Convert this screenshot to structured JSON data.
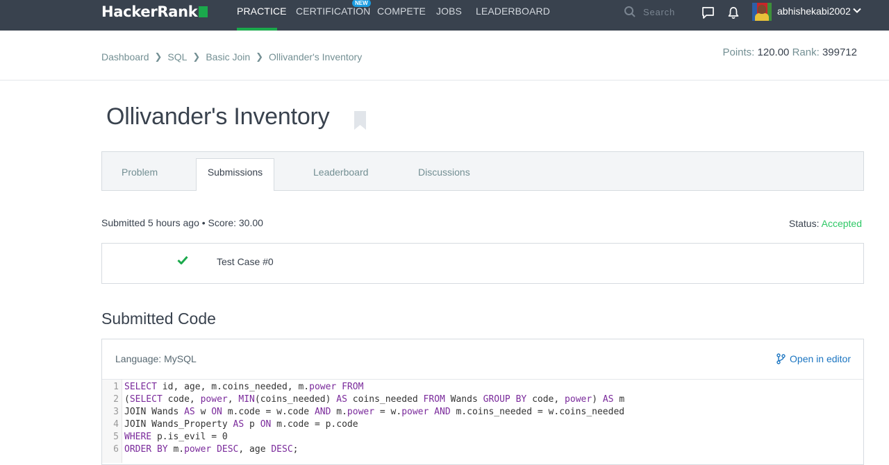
{
  "nav": {
    "logo": "HackerRank",
    "items": [
      "PRACTICE",
      "CERTIFICATION",
      "COMPETE",
      "JOBS",
      "LEADERBOARD"
    ],
    "new_badge": "NEW",
    "search_placeholder": "Search",
    "username": "abhishekabi2002"
  },
  "breadcrumb": {
    "items": [
      "Dashboard",
      "SQL",
      "Basic Join",
      "Ollivander's Inventory"
    ],
    "points_label": "Points:",
    "points_value": "120.00",
    "rank_label": "Rank:",
    "rank_value": "399712"
  },
  "title": "Ollivander's Inventory",
  "tabs": [
    "Problem",
    "Submissions",
    "Leaderboard",
    "Discussions"
  ],
  "submission": {
    "summary": "Submitted 5 hours ago • Score: 30.00",
    "status_label": "Status:",
    "status_value": "Accepted",
    "test_case": "Test Case #0"
  },
  "code": {
    "heading": "Submitted Code",
    "language": "Language: MySQL",
    "open_editor": "Open in editor",
    "line_numbers": [
      "1",
      "2",
      "3",
      "4",
      "5",
      "6"
    ]
  },
  "colors": {
    "nav_bg": "#39424e",
    "accent_green": "#1ba94c",
    "accepted": "#2ec866",
    "link_blue": "#1b75c1"
  },
  "icons": [
    "search-icon",
    "chat-icon",
    "bell-icon",
    "chevron-down-icon",
    "bookmark-icon",
    "check-icon",
    "branch-icon"
  ]
}
